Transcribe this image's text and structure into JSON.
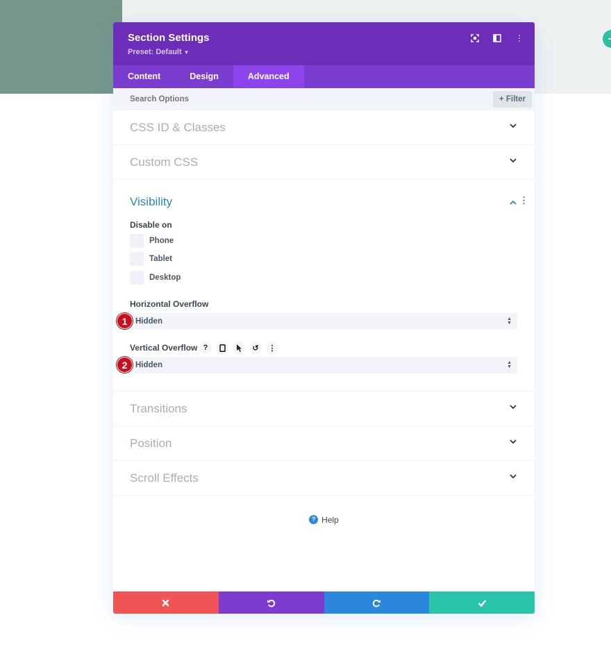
{
  "modal": {
    "title": "Section Settings",
    "preset": "Preset: Default",
    "header_icons": [
      "focus-icon",
      "split-view-icon",
      "more-options-icon"
    ]
  },
  "tabs": [
    {
      "label": "Content",
      "active": false
    },
    {
      "label": "Design",
      "active": false
    },
    {
      "label": "Advanced",
      "active": true
    }
  ],
  "search": {
    "placeholder": "Search Options",
    "value": ""
  },
  "filter": {
    "label": "Filter"
  },
  "sections_top": [
    {
      "label": "CSS ID & Classes",
      "state": "collapsed"
    },
    {
      "label": "Custom CSS",
      "state": "collapsed"
    }
  ],
  "visibility": {
    "title": "Visibility",
    "state": "expanded",
    "disable_on_label": "Disable on",
    "checkboxes": [
      {
        "label": "Phone",
        "checked": false
      },
      {
        "label": "Tablet",
        "checked": false
      },
      {
        "label": "Desktop",
        "checked": false
      }
    ],
    "horizontal_overflow": {
      "label": "Horizontal Overflow",
      "value": "Hidden",
      "badge": "1"
    },
    "vertical_overflow": {
      "label": "Vertical Overflow",
      "value": "Hidden",
      "badge": "2",
      "icons": [
        "help-icon",
        "responsive-icon",
        "hover-icon",
        "reset-icon",
        "more-icon"
      ]
    }
  },
  "sections_bottom": [
    {
      "label": "Transitions",
      "state": "collapsed"
    },
    {
      "label": "Position",
      "state": "collapsed"
    },
    {
      "label": "Scroll Effects",
      "state": "collapsed"
    }
  ],
  "help": {
    "label": "Help"
  },
  "footer": {
    "buttons": [
      {
        "name": "cancel",
        "color": "#ef5555"
      },
      {
        "name": "undo",
        "color": "#7e3bd0"
      },
      {
        "name": "redo",
        "color": "#2b87da"
      },
      {
        "name": "save",
        "color": "#29c4a9"
      }
    ]
  },
  "colors": {
    "header": "#6c2eb9",
    "tabs": "#7b3dd0",
    "active_tab": "#8e44ec",
    "accent_blue": "#2b87ba",
    "badge_red": "#c8101d"
  }
}
